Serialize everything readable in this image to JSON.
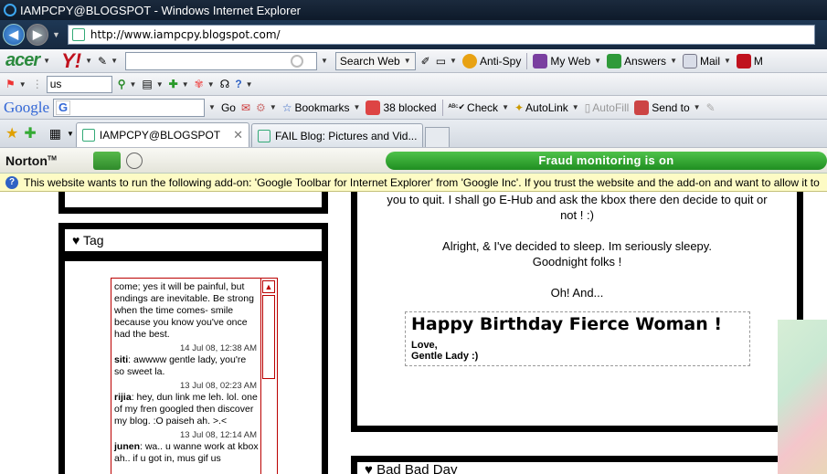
{
  "window": {
    "title": "IAMPCPY@BLOGSPOT - Windows Internet Explorer",
    "url": "http://www.iampcpy.blogspot.com/"
  },
  "acer_toolbar": {
    "brand": "acer",
    "yahoo": "Y!",
    "search_button": "Search Web",
    "items": [
      "Anti-Spy",
      "My Web",
      "Answers",
      "Mail",
      "M"
    ]
  },
  "ask_toolbar": {
    "search_value": "us"
  },
  "google_toolbar": {
    "logo": "Google",
    "go_label": "Go",
    "bookmarks": "Bookmarks",
    "blocked": "38 blocked",
    "check": "Check",
    "autolink": "AutoLink",
    "autofill": "AutoFill",
    "sendto": "Send to"
  },
  "tabs": [
    {
      "label": "IAMPCPY@BLOGSPOT",
      "active": true
    },
    {
      "label": "FAIL Blog: Pictures and Vid...",
      "active": false
    }
  ],
  "norton": {
    "brand": "Norton",
    "fraud_status": "Fraud monitoring is on"
  },
  "info_bar": {
    "message": "This website wants to run the following add-on: 'Google Toolbar for Internet Explorer' from 'Google Inc'. If you trust the website and the add-on and want to allow it to"
  },
  "sidebar": {
    "tag_title": "♥ Tag",
    "messages": [
      {
        "author": "",
        "text": "come; yes it will be painful, but endings are inevitable. Be strong when the time comes- smile because you know you've once had the best.",
        "time": "14 Jul 08, 12:38 AM"
      },
      {
        "author": "siti",
        "text": ": awwww gentle lady, you're so sweet la.",
        "time": "13 Jul 08, 02:23 AM"
      },
      {
        "author": "rijia",
        "text": ": hey, dun link me leh. lol. one of my fren googled then discover my blog. :O paiseh ah. >.<",
        "time": "13 Jul 08, 12:14 AM"
      },
      {
        "author": "junen",
        "text": ": wa.. u wanne work at kbox ah.. if u got in, mus gif us",
        "time": ""
      }
    ]
  },
  "post": {
    "lines": [
      "you to quit.  I shall go E-Hub and ask the kbox there den decide to quit or",
      "not ! :)",
      "",
      "Alright, & I've decided to sleep. Im seriously sleepy.",
      "Goodnight folks !",
      "",
      "Oh! And..."
    ],
    "birthday_title": "Happy Birthday Fierce Woman !",
    "birthday_line1": "Love,",
    "birthday_line2": "Gentle Lady :)",
    "next_title": "♥ Bad Bad Day"
  }
}
